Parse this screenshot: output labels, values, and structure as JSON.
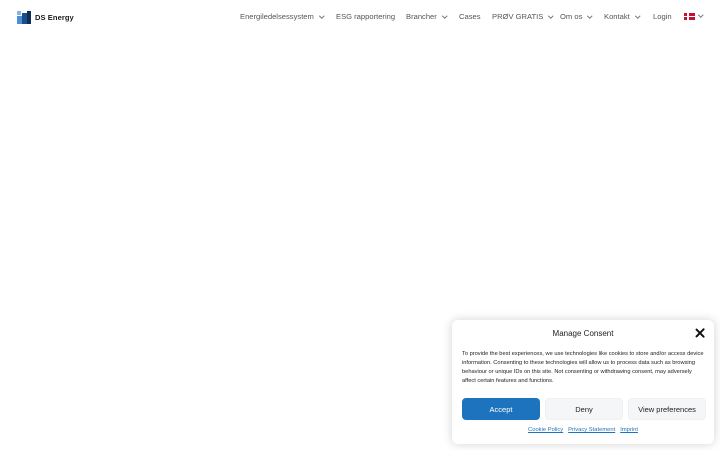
{
  "brand": {
    "name": "DS Energy"
  },
  "nav": {
    "items": [
      {
        "label": "Energiledelsessystem",
        "dropdown": true
      },
      {
        "label": "ESG rapportering",
        "dropdown": false
      },
      {
        "label": "Brancher",
        "dropdown": true
      },
      {
        "label": "Cases",
        "dropdown": false
      },
      {
        "label": "PRØV GRATIS",
        "dropdown": true
      },
      {
        "label": "Om os",
        "dropdown": true
      },
      {
        "label": "Kontakt",
        "dropdown": true
      },
      {
        "label": "Login",
        "dropdown": false
      }
    ],
    "language_flag": "flag-denmark-icon"
  },
  "consent": {
    "title": "Manage Consent",
    "body": "To provide the best experiences, we use technologies like cookies to store and/or access device information. Consenting to these technologies will allow us to process data such as browsing behaviour or unique IDs on this site. Not consenting or withdrawing consent, may adversely affect certain features and functions.",
    "accept_label": "Accept",
    "deny_label": "Deny",
    "preferences_label": "View preferences",
    "links": [
      "Cookie Policy",
      "Privacy Statement",
      "Imprint"
    ]
  },
  "colors": {
    "accent": "#1e73be",
    "danish_red": "#c8102e"
  }
}
